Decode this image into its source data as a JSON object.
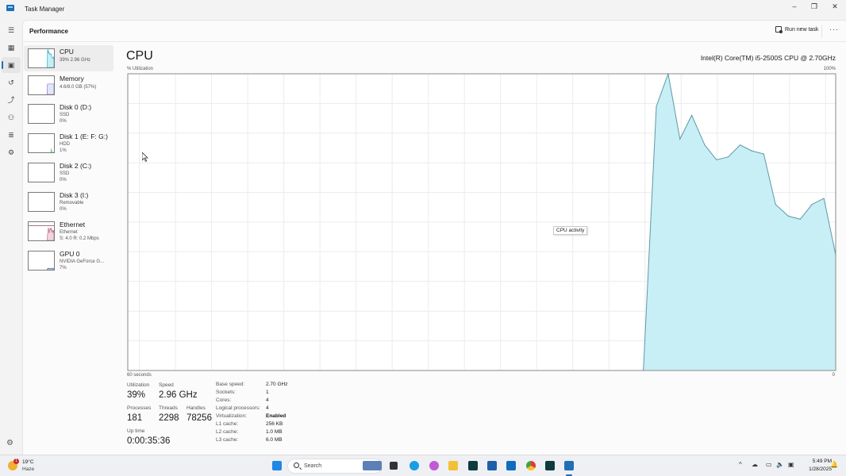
{
  "window": {
    "title": "Task Manager",
    "minimize_label": "–",
    "restore_label": "❐",
    "close_label": "✕"
  },
  "navrail": {
    "items": [
      {
        "name": "menu",
        "icon": "☰"
      },
      {
        "name": "processes",
        "icon": "▦"
      },
      {
        "name": "performance",
        "icon": "▣",
        "active": true
      },
      {
        "name": "app-history",
        "icon": "↺"
      },
      {
        "name": "startup-apps",
        "icon": "⤴"
      },
      {
        "name": "users",
        "icon": "⚇"
      },
      {
        "name": "details",
        "icon": "≣"
      },
      {
        "name": "services",
        "icon": "⚙"
      }
    ],
    "settings_icon": "⚙"
  },
  "header": {
    "page_title": "Performance",
    "run_new_task_label": "Run new task",
    "more_label": "···"
  },
  "perf_list": [
    {
      "name": "CPU",
      "sub1": "39% 2.96 GHz",
      "sub2": "",
      "color": "#17a2b8",
      "fill": "#c5eef5",
      "series": [
        0,
        0,
        0,
        0,
        0,
        0,
        0,
        0,
        0,
        0,
        0,
        0,
        0,
        0,
        0,
        0,
        0,
        0,
        0,
        0,
        0,
        0,
        0,
        0,
        0,
        0,
        0,
        0,
        0,
        0,
        0,
        0,
        0,
        0,
        0,
        0,
        0,
        0,
        0,
        0,
        0,
        0,
        0,
        0,
        89,
        100,
        78,
        86,
        76,
        71,
        72,
        76,
        74,
        73,
        56,
        52,
        51,
        56,
        58,
        39
      ]
    },
    {
      "name": "Memory",
      "sub1": "4.6/8.0 GB (57%)",
      "sub2": "",
      "color": "#8a4fc8",
      "fill": "#dfe8f7",
      "series": [
        0,
        0,
        0,
        0,
        0,
        0,
        0,
        0,
        0,
        0,
        0,
        0,
        0,
        0,
        0,
        0,
        0,
        0,
        0,
        0,
        0,
        0,
        0,
        0,
        0,
        0,
        0,
        0,
        0,
        0,
        0,
        0,
        0,
        0,
        0,
        0,
        0,
        0,
        0,
        0,
        0,
        0,
        0,
        0,
        57,
        57,
        57,
        57,
        57,
        57,
        57,
        57,
        57,
        57,
        57,
        57,
        57,
        57,
        57,
        57
      ]
    },
    {
      "name": "Disk 0 (D:)",
      "sub1": "SSD",
      "sub2": "0%",
      "color": "#4caf50",
      "fill": "#e3f3e3",
      "series": []
    },
    {
      "name": "Disk 1 (E: F: G:)",
      "sub1": "HDD",
      "sub2": "1%",
      "color": "#4caf50",
      "fill": "#e3f3e3",
      "series": [
        0,
        0,
        0,
        0,
        0,
        0,
        0,
        0,
        0,
        0,
        0,
        0,
        0,
        0,
        0,
        0,
        0,
        0,
        0,
        0,
        0,
        0,
        0,
        0,
        0,
        0,
        0,
        0,
        0,
        0,
        0,
        0,
        0,
        0,
        0,
        0,
        0,
        0,
        0,
        0,
        0,
        0,
        0,
        0,
        0,
        0,
        0,
        0,
        0,
        0,
        0,
        0,
        0,
        20,
        0,
        0,
        0,
        0,
        0,
        1
      ]
    },
    {
      "name": "Disk 2 (C:)",
      "sub1": "SSD",
      "sub2": "0%",
      "color": "#4caf50",
      "fill": "#e3f3e3",
      "series": []
    },
    {
      "name": "Disk 3 (I:)",
      "sub1": "Removable",
      "sub2": "0%",
      "color": "#4caf50",
      "fill": "#e3f3e3",
      "series": []
    },
    {
      "name": "Ethernet",
      "sub1": "Ethernet",
      "sub2": "S: 4.0 R: 0.2 Mbps",
      "color": "#b05a7a",
      "fill": "#f0d5df",
      "series": [
        0,
        0,
        0,
        0,
        0,
        0,
        0,
        0,
        0,
        0,
        0,
        0,
        0,
        0,
        0,
        0,
        0,
        0,
        0,
        0,
        0,
        0,
        0,
        0,
        0,
        0,
        0,
        0,
        0,
        0,
        0,
        0,
        0,
        0,
        0,
        0,
        0,
        0,
        0,
        0,
        0,
        0,
        0,
        0,
        30,
        50,
        70,
        60,
        40,
        55,
        65,
        60,
        70,
        55,
        45,
        60,
        50,
        40,
        55,
        45
      ]
    },
    {
      "name": "GPU 0",
      "sub1": "NVIDIA GeForce G...",
      "sub2": "7%",
      "color": "#3949ab",
      "fill": "#dde0f5",
      "series": [
        0,
        0,
        0,
        0,
        0,
        0,
        0,
        0,
        0,
        0,
        0,
        0,
        0,
        0,
        0,
        0,
        0,
        0,
        0,
        0,
        0,
        0,
        0,
        0,
        0,
        0,
        0,
        0,
        0,
        0,
        0,
        0,
        0,
        0,
        0,
        0,
        0,
        0,
        0,
        0,
        0,
        0,
        0,
        0,
        5,
        8,
        6,
        7,
        9,
        8,
        7,
        6,
        8,
        7,
        6,
        9,
        7,
        8,
        7,
        7
      ]
    }
  ],
  "main": {
    "title": "CPU",
    "model": "Intel(R) Core(TM) i5-2500S CPU @ 2.70GHz",
    "tooltip": "CPU activity"
  },
  "chart_data": {
    "type": "area",
    "title": "CPU",
    "ylabel": "% Utilization",
    "y_max_label": "100%",
    "y_min_label": "0",
    "x_left_label": "60 seconds",
    "ylim": [
      0,
      100
    ],
    "xlim": [
      60,
      0
    ],
    "grid": true,
    "line_color": "#5c9aa6",
    "fill_color": "#c5eef5",
    "series": [
      {
        "name": "CPU utilization",
        "seconds_ago": [
          16.3,
          15.2,
          14.2,
          13.2,
          12.2,
          11.1,
          10.1,
          9.1,
          8.1,
          7.1,
          6.1,
          5.1,
          4.0,
          3.0,
          2.0,
          1.0,
          0
        ],
        "values": [
          0,
          89,
          100,
          78,
          86,
          76,
          71,
          72,
          76,
          74,
          73,
          56,
          52,
          51,
          56,
          58,
          39
        ]
      }
    ]
  },
  "stats": {
    "utilization_label": "Utilization",
    "utilization": "39%",
    "speed_label": "Speed",
    "speed": "2.96 GHz",
    "processes_label": "Processes",
    "processes": "181",
    "threads_label": "Threads",
    "threads": "2298",
    "handles_label": "Handles",
    "handles": "78256",
    "uptime_label": "Up time",
    "uptime": "0:00:35:36"
  },
  "specs": [
    {
      "label": "Base speed:",
      "value": "2.70 GHz",
      "bold": false
    },
    {
      "label": "Sockets:",
      "value": "1",
      "bold": false
    },
    {
      "label": "Cores:",
      "value": "4",
      "bold": false
    },
    {
      "label": "Logical processors:",
      "value": "4",
      "bold": false
    },
    {
      "label": "Virtualization:",
      "value": "Enabled",
      "bold": true
    },
    {
      "label": "L1 cache:",
      "value": "256 KB",
      "bold": false
    },
    {
      "label": "L2 cache:",
      "value": "1.0 MB",
      "bold": false
    },
    {
      "label": "L3 cache:",
      "value": "6.0 MB",
      "bold": false
    }
  ],
  "taskbar": {
    "weather_temp": "19°C",
    "weather_desc": "Haze",
    "weather_badge": "1",
    "search_placeholder": "Search",
    "apps": [
      {
        "name": "start",
        "color": "#1e88e5"
      },
      {
        "name": "widgets-news",
        "color": "#5d7fb8"
      },
      {
        "name": "file-viewer",
        "color": "#333333"
      },
      {
        "name": "edge",
        "color": "#1b9de2"
      },
      {
        "name": "copilot",
        "color": "#c05ad6"
      },
      {
        "name": "file-explorer",
        "color": "#f2c037"
      },
      {
        "name": "terminal-app-1",
        "color": "#0d3b3e"
      },
      {
        "name": "microsoft-store",
        "color": "#1f5fa8"
      },
      {
        "name": "outlook",
        "color": "#0f6cbd"
      },
      {
        "name": "chrome",
        "color": "#e53935"
      },
      {
        "name": "terminal-app-2",
        "color": "#0d3b3e"
      },
      {
        "name": "task-manager",
        "color": "#1f6fb5"
      }
    ],
    "tray_chevron": "^",
    "tray_icons": [
      "☁",
      "▭",
      "🔈",
      "▣"
    ],
    "time": "5:49 PM",
    "date": "1/28/2025",
    "notification_icon": "🔔"
  }
}
